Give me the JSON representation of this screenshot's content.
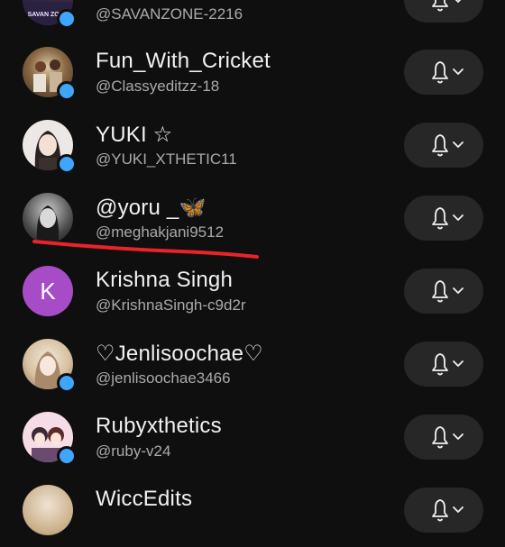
{
  "subscriptions": [
    {
      "name": "",
      "handle": "@SAVANZONE-2216",
      "avatar_label": "SAVAN ZONE",
      "avatar_colors": [
        "#2a1f3a",
        "#5b3b6d"
      ],
      "verified_dot": true
    },
    {
      "name": "Fun_With_Cricket",
      "handle": "@Classyeditzz-18",
      "avatar_label": "",
      "avatar_colors": [
        "#6b4a2e",
        "#c8b79a"
      ],
      "verified_dot": true
    },
    {
      "name": "YUKI ☆",
      "handle": "@YUKI_XTHETIC11",
      "avatar_label": "",
      "avatar_colors": [
        "#e9e6e4",
        "#5a4a45"
      ],
      "verified_dot": true
    },
    {
      "name": "@yoru _🦋",
      "handle": "@meghakjani9512",
      "avatar_label": "",
      "avatar_colors": [
        "#d8d8d8",
        "#2b2b2b"
      ],
      "verified_dot": false
    },
    {
      "name": "Krishna Singh",
      "handle": "@KrishnaSingh-c9d2r",
      "avatar_letter": "K",
      "avatar_colors": [
        "#a64cc6",
        "#a64cc6"
      ],
      "verified_dot": false
    },
    {
      "name": "♡Jenlisoochae♡",
      "handle": "@jenlisoochae3466",
      "avatar_label": "",
      "avatar_colors": [
        "#efe6d6",
        "#c4a98a"
      ],
      "verified_dot": true
    },
    {
      "name": "Rubyxthetics",
      "handle": "@ruby-v24",
      "avatar_label": "",
      "avatar_colors": [
        "#f4d7e2",
        "#4a3a52"
      ],
      "verified_dot": true
    },
    {
      "name": "WiccEdits",
      "handle": "",
      "avatar_label": "",
      "avatar_colors": [
        "#e8dcc9",
        "#b59c7c"
      ],
      "verified_dot": false
    }
  ],
  "colors": {
    "background": "#0f0f0f",
    "button_bg": "#272727",
    "verified_blue": "#3ea6ff",
    "underline_red": "#e8232a"
  },
  "icons": {
    "bell": "bell-icon",
    "chevron": "chevron-down-icon"
  }
}
